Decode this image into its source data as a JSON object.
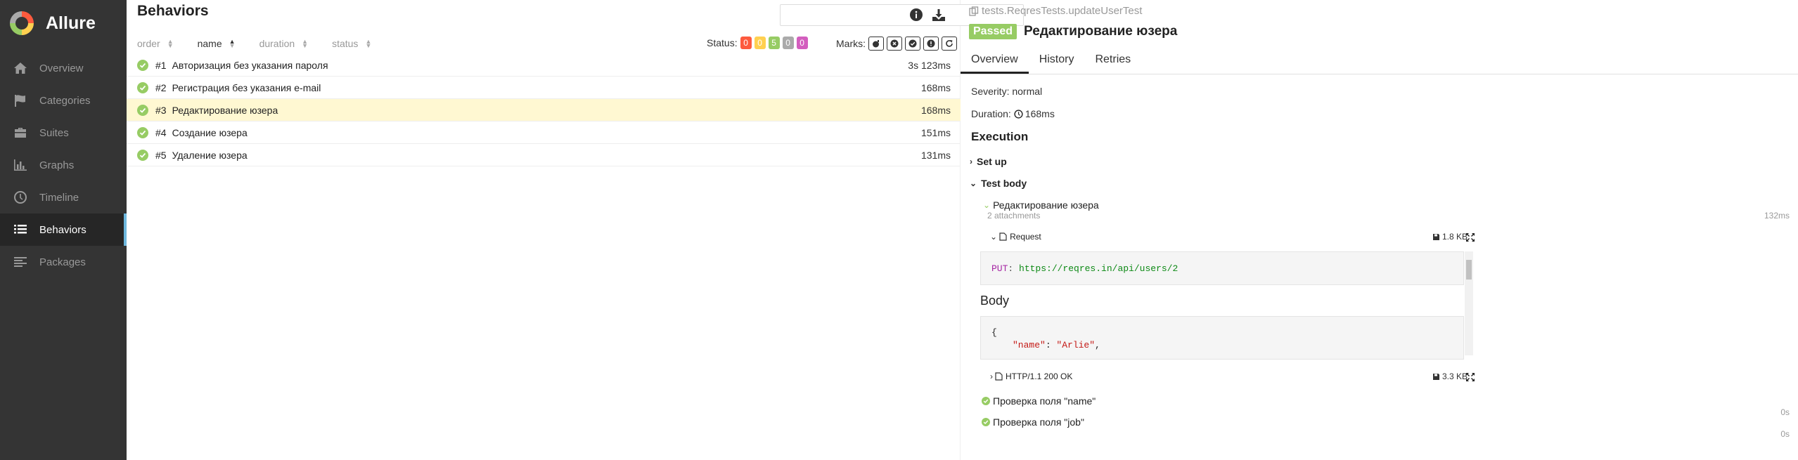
{
  "app": {
    "name": "Allure"
  },
  "sidebar": {
    "items": [
      {
        "label": "Overview",
        "icon": "home-icon"
      },
      {
        "label": "Categories",
        "icon": "flag-icon"
      },
      {
        "label": "Suites",
        "icon": "briefcase-icon"
      },
      {
        "label": "Graphs",
        "icon": "bar-chart-icon"
      },
      {
        "label": "Timeline",
        "icon": "clock-icon"
      },
      {
        "label": "Behaviors",
        "icon": "list-icon",
        "active": true
      },
      {
        "label": "Packages",
        "icon": "align-left-icon"
      }
    ]
  },
  "tree": {
    "title": "Behaviors",
    "search_placeholder": "",
    "sort": {
      "order": "order",
      "name": "name",
      "duration": "duration",
      "status": "status"
    },
    "status_label": "Status:",
    "status_counts": [
      {
        "value": "0",
        "color": "#fd5a3e"
      },
      {
        "value": "0",
        "color": "#ffd050"
      },
      {
        "value": "5",
        "color": "#97cc64"
      },
      {
        "value": "0",
        "color": "#aaaaaa"
      },
      {
        "value": "0",
        "color": "#d35ebe"
      }
    ],
    "marks_label": "Marks:",
    "rows": [
      {
        "order": "#1",
        "name": "Авторизация без указания пароля",
        "duration": "3s 123ms"
      },
      {
        "order": "#2",
        "name": "Регистрация без указания e-mail",
        "duration": "168ms"
      },
      {
        "order": "#3",
        "name": "Редактирование юзера",
        "duration": "168ms"
      },
      {
        "order": "#4",
        "name": "Создание юзера",
        "duration": "151ms"
      },
      {
        "order": "#5",
        "name": "Удаление юзера",
        "duration": "131ms"
      }
    ]
  },
  "detail": {
    "breadcrumb": "tests.ReqresTests.updateUserTest",
    "status": "Passed",
    "title": "Редактирование юзера",
    "tabs": [
      "Overview",
      "History",
      "Retries"
    ],
    "severity": "Severity: normal",
    "duration_label": "Duration:",
    "duration_value": "168ms",
    "execution_title": "Execution",
    "setup_label": "Set up",
    "test_body_label": "Test body",
    "step_name": "Редактирование юзера",
    "attachments_count": "2 attachments",
    "step_duration": "132ms",
    "request_label": "Request",
    "request_size": "1.8 KB",
    "request_method": "PUT",
    "request_url": "https://reqres.in/api/users/2",
    "body_title": "Body",
    "body_open": "{",
    "body_key": "\"name\"",
    "body_value": "\"Arlie\"",
    "response_label": "HTTP/1.1 200 OK",
    "response_size": "3.3 KB",
    "checks": [
      {
        "label": "Проверка поля \"name\"",
        "duration": "0s"
      },
      {
        "label": "Проверка поля \"job\"",
        "duration": "0s"
      }
    ]
  }
}
